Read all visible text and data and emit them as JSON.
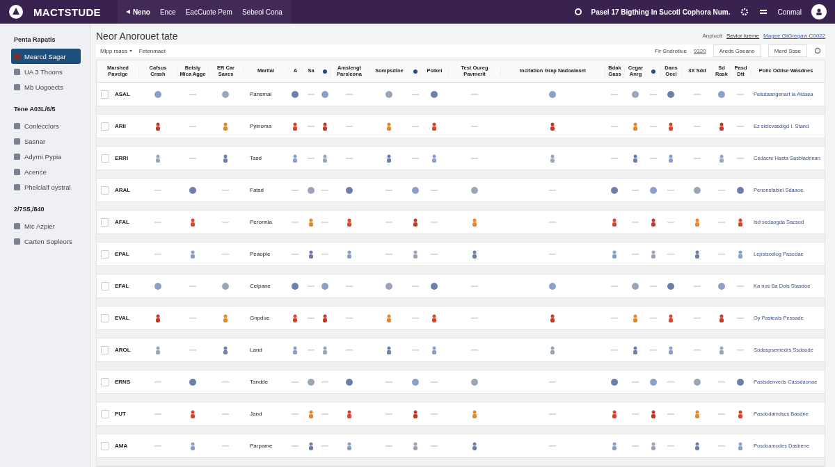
{
  "topbar": {
    "brand": "MACTSTUDE",
    "nav": [
      {
        "label": "Neno",
        "selected": true
      },
      {
        "label": "Ence",
        "selected": false
      },
      {
        "label": "EacCuote Pem",
        "selected": false
      },
      {
        "label": "Sebeol Cona",
        "selected": false
      }
    ],
    "notice": "Pasel 17  Bigthing In Sucotl Cophora Num.",
    "user": "Conmal"
  },
  "sidebar": {
    "sections": [
      {
        "heading": "Penta Rapatis",
        "items": [
          {
            "label": "Mearcd Sagar",
            "selected": true
          },
          {
            "label": "UA 3 Thoons",
            "selected": false
          },
          {
            "label": "Mb Uogoects",
            "selected": false
          }
        ]
      },
      {
        "heading": "Tene A03L/6/5",
        "items": [
          {
            "label": "Conlecclors",
            "selected": false
          },
          {
            "label": "Sasnar",
            "selected": false
          },
          {
            "label": "Adyrni Pypia",
            "selected": false
          },
          {
            "label": "Acence",
            "selected": false
          },
          {
            "label": "Phelclalf oystral",
            "selected": false
          }
        ]
      },
      {
        "heading": "2/7S5,/840",
        "items": [
          {
            "label": "Mic Azpier",
            "selected": false
          },
          {
            "label": "Carten Sopleors",
            "selected": false
          }
        ]
      }
    ]
  },
  "page": {
    "title": "Neor Anorouet tate",
    "meta_label": "Anplucit",
    "links": [
      "Sevior Iueme",
      "Magee GtGregaw C0022"
    ]
  },
  "toolbar": {
    "filters": [
      "Mlpp rsass",
      "Fetenmaet"
    ],
    "count_label": "Fir Sndrotiue",
    "count": "9320",
    "buttons": [
      "Areds Gseano",
      "Merd Ssse"
    ]
  },
  "table": {
    "columns": [
      "Marshed Pavelge",
      "Cafsus Crash",
      "Betsly Mica Agge",
      "ER Car Saxes",
      "Marital",
      "A",
      "Sa",
      "",
      "Amslengt Parsleona",
      "Sompsdine",
      "",
      "Polkei",
      "Test Oureg Pavmerit",
      "Incitation Grap Nadoalaset",
      "Bdak Gass",
      "Cegar Anrg",
      "",
      "Dans Ocel",
      "3X Sdd",
      "Sd Rask",
      "Pasd Dtt",
      "Polic Odiise Wasdnes"
    ],
    "rows": [
      {
        "code": "ASAL",
        "name": "Pansmal",
        "note": "Pelsdaangenart ia Aldaea",
        "checked": false
      },
      {
        "code": "ARII",
        "name": "Pyinoma",
        "note": "Ez siclcvasdigd I. Stand",
        "checked": false
      },
      {
        "code": "ERRI",
        "name": "Tasd",
        "note": "Cedacre Hasta Sasbladrinan",
        "checked": false
      },
      {
        "code": "ARAL",
        "name": "Fatsd",
        "note": "Penonsfabiel Sdaaoe",
        "checked": false
      },
      {
        "code": "AFAL",
        "name": "Peronnla",
        "note": "Isd sedaogda Sacsod",
        "checked": false
      },
      {
        "code": "EPAL",
        "name": "Peaople",
        "note": "Lepslsodiog Pasedae",
        "checked": false
      },
      {
        "code": "EFAL",
        "name": "Celpane",
        "note": "Ka nos Ba Dols Stasdoe",
        "checked": false
      },
      {
        "code": "EVAL",
        "name": "Gnpdue",
        "note": "Oy Pasteals Pessade",
        "checked": false
      },
      {
        "code": "AROL",
        "name": "Land",
        "note": "Sodaspsemedrs Ssdaode",
        "checked": false
      },
      {
        "code": "ERNS",
        "name": "Tandde",
        "note": "Pastsdenveds Cassdaonae",
        "checked": false
      },
      {
        "code": "PUT",
        "name": "Jand",
        "note": "Pasdodamdscs Basdne",
        "checked": false
      },
      {
        "code": "AMA",
        "name": "Parpame",
        "note": "Posdoamodes Dasbene",
        "checked": false
      }
    ]
  }
}
